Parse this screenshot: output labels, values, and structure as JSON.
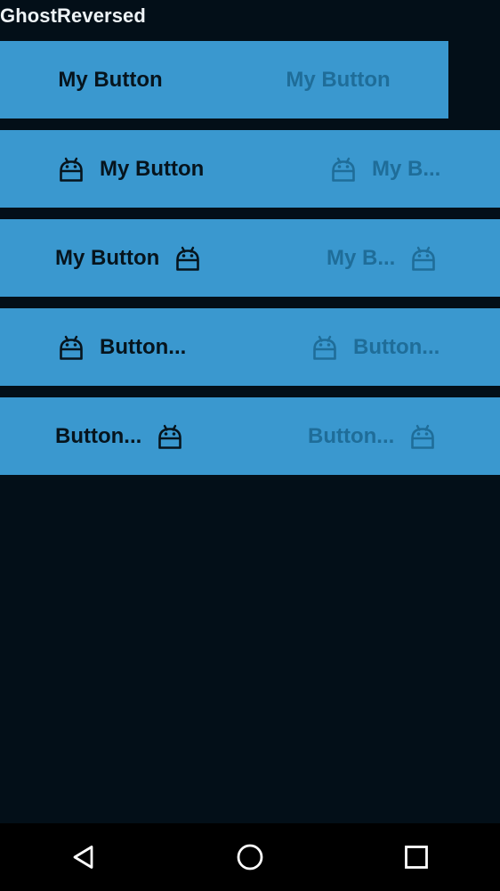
{
  "app": {
    "title": "GhostReversed"
  },
  "rows": [
    {
      "enabled_label": "My Button",
      "disabled_label": "My Button",
      "icon": "android-icon",
      "icon_position": "none"
    },
    {
      "enabled_label": "My Button",
      "disabled_label": "My B...",
      "icon": "android-icon",
      "icon_position": "left"
    },
    {
      "enabled_label": "My Button",
      "disabled_label": "My B...",
      "icon": "android-icon",
      "icon_position": "right"
    },
    {
      "enabled_label": "Button...",
      "disabled_label": "Button...",
      "icon": "android-icon",
      "icon_position": "left"
    },
    {
      "enabled_label": "Button...",
      "disabled_label": "Button...",
      "icon": "android-icon",
      "icon_position": "right"
    }
  ],
  "navigation": {
    "back_icon": "back-triangle-icon",
    "home_icon": "home-circle-icon",
    "recents_icon": "recents-square-icon"
  },
  "colors": {
    "background": "#030f18",
    "button_fill": "#3a98cf",
    "enabled_text": "#06141d",
    "disabled_text": "#1f6d99",
    "navbar": "#000000"
  }
}
